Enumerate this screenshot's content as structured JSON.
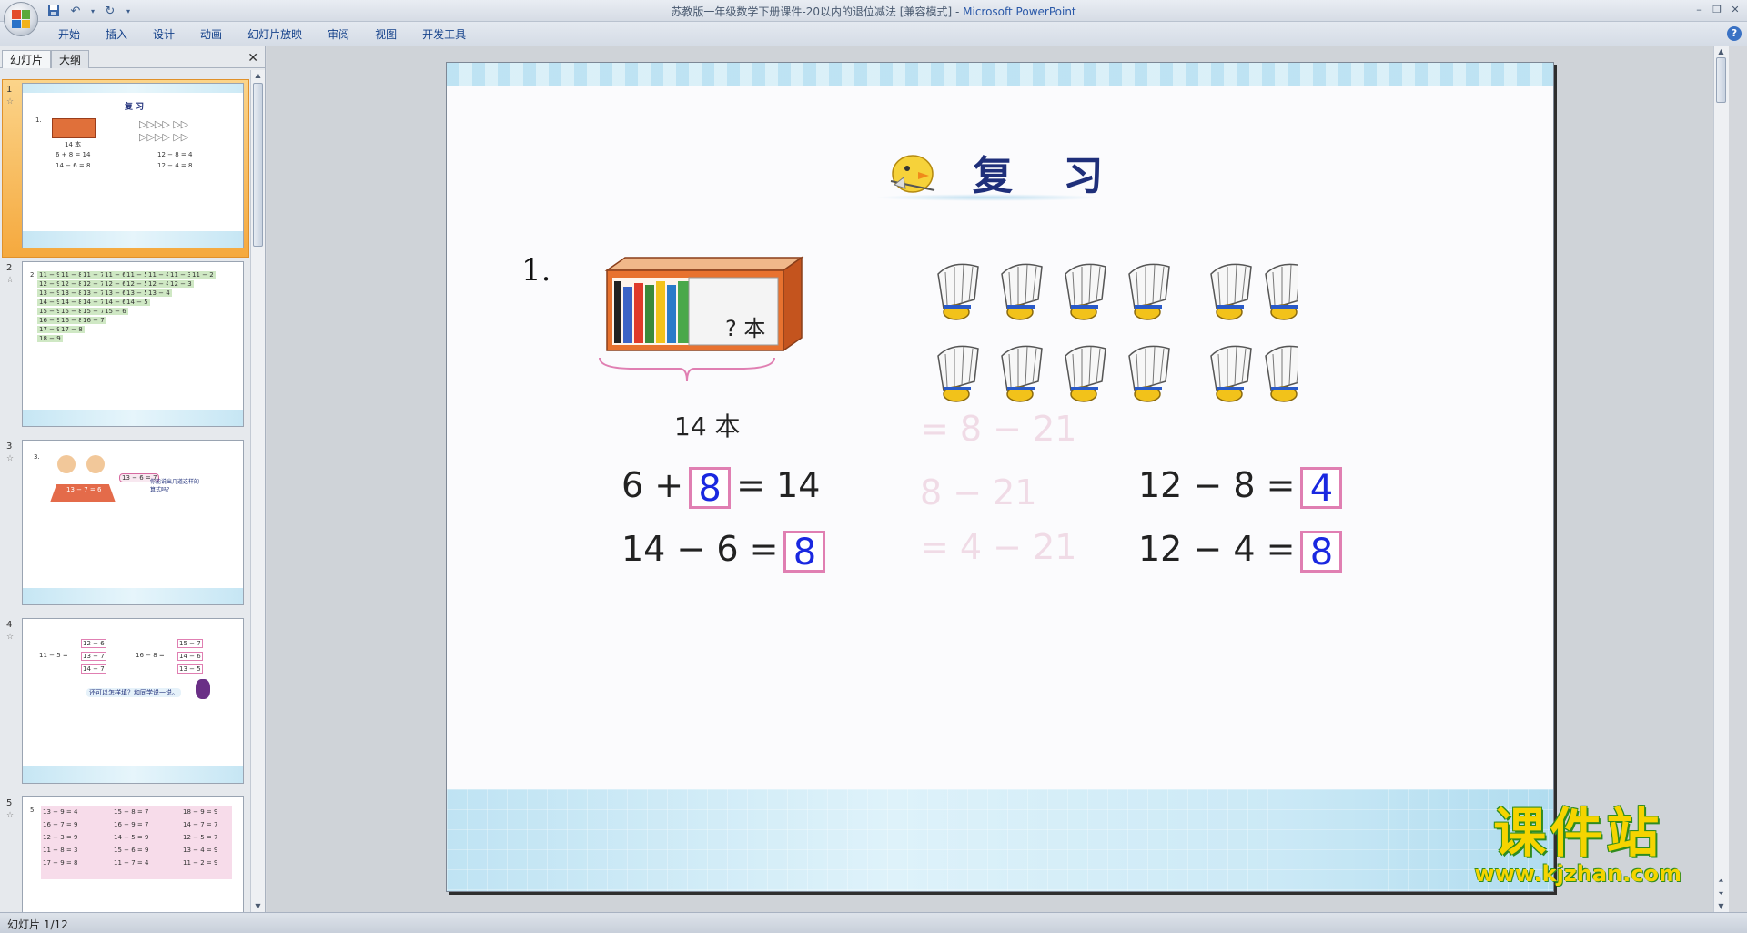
{
  "window": {
    "title": "苏教版一年级数学下册课件-20以内的退位减法 [兼容模式]",
    "app_name": "Microsoft PowerPoint"
  },
  "ribbon": {
    "tabs": [
      "开始",
      "插入",
      "设计",
      "动画",
      "幻灯片放映",
      "审阅",
      "视图",
      "开发工具"
    ]
  },
  "left_pane": {
    "tabs": [
      "幻灯片",
      "大纲"
    ]
  },
  "thumbnails": [
    {
      "number": "1",
      "title": "复 习",
      "items": [
        "1.",
        "14 本",
        "6 + 8 = 14",
        "14 − 6 = 8",
        "12 − 8 = 4",
        "12 − 4 = 8"
      ]
    },
    {
      "number": "2",
      "items": [
        "2.",
        "11 − 9",
        "11 − 8",
        "11 − 7",
        "11 − 6",
        "11 − 5",
        "11 − 4",
        "11 − 3",
        "11 − 2",
        "12 − 9",
        "12 − 8",
        "12 − 7",
        "12 − 6",
        "12 − 5",
        "12 − 4",
        "12 − 3",
        "13 − 9",
        "13 − 8",
        "13 − 7",
        "13 − 6",
        "13 − 5",
        "13 − 4",
        "14 − 9",
        "14 − 8",
        "14 − 7",
        "14 − 6",
        "14 − 5",
        "15 − 9",
        "15 − 8",
        "15 − 7",
        "15 − 6",
        "16 − 9",
        "16 − 8",
        "16 − 7",
        "17 − 9",
        "17 − 8",
        "18 − 9"
      ]
    },
    {
      "number": "3",
      "items": [
        "3.",
        "13 − 6 = 7",
        "13 − 7 = 6",
        "你能说出几道这样的算式吗？"
      ]
    },
    {
      "number": "4",
      "items": [
        "11 − 5 =",
        "16 − 8 =",
        "12 − 6",
        "13 − 7",
        "14 − 7",
        "15 − 7",
        "14 − 6",
        "13 − 5",
        "还可以怎样填？和同学说一说。"
      ]
    },
    {
      "number": "5",
      "items": [
        "5.",
        "13 − 9 = 4",
        "15 − 8 = 7",
        "18 − 9 = 9",
        "16 − 7 = 9",
        "16 − 9 = 7",
        "14 − 7 = 7",
        "12 − 3 = 9",
        "14 − 5 = 9",
        "12 − 5 = 7",
        "11 − 8 = 3",
        "15 − 6 = 9",
        "13 − 4 = 9",
        "17 − 9 = 8",
        "11 − 7 = 4",
        "11 − 2 = 9"
      ]
    }
  ],
  "slide": {
    "title": "复 习",
    "question_number": "1.",
    "book_question": "? 本",
    "book_total_label": "14 本",
    "equations": [
      {
        "left": "6 +",
        "answer": "8",
        "right": "= 14"
      },
      {
        "left": "14 − 6 =",
        "answer": "8",
        "right": ""
      },
      {
        "left": "12 − 8 =",
        "answer": "4",
        "right": ""
      },
      {
        "left": "12 − 4 =",
        "answer": "8",
        "right": ""
      }
    ],
    "shuttlecock_groups": [
      8,
      4
    ]
  },
  "watermark": {
    "chinese": "课件站",
    "url": "www.kjzhan.com"
  },
  "status_bar": {
    "slide_position": "幻灯片 1/12"
  },
  "colors": {
    "answer_text": "#1a28e0",
    "answer_border": "#e07fb2",
    "title_text": "#1f2f7a",
    "selected_thumb": "#f5a93e"
  }
}
